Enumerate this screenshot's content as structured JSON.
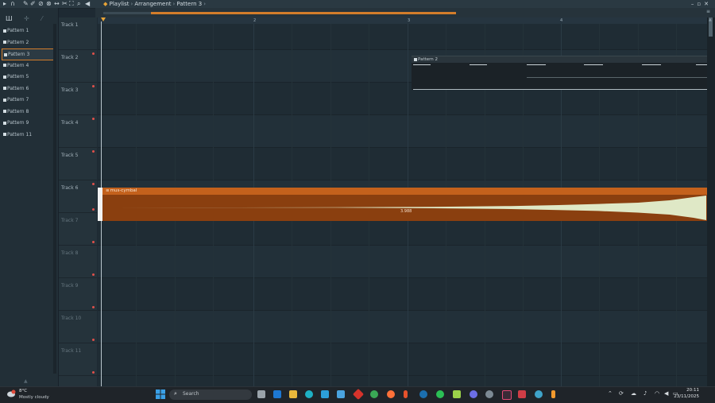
{
  "title": {
    "parts": [
      "Playlist",
      "Arrangement",
      "Pattern 3"
    ],
    "separator": "›",
    "trailing": "›"
  },
  "toolbar_icons": [
    "play-icon",
    "magnet-icon",
    "pencil-icon",
    "brush-icon",
    "delete-icon",
    "mute-icon",
    "slip-icon",
    "slice-icon",
    "select-icon",
    "zoom-icon",
    "speaker-icon"
  ],
  "left_panel": {
    "tools": [
      "piano-icon",
      "move-icon",
      "pencil-icon"
    ],
    "patterns": [
      "Pattern 1",
      "Pattern 2",
      "Pattern 3",
      "Pattern 4",
      "Pattern 5",
      "Pattern 6",
      "Pattern 7",
      "Pattern 8",
      "Pattern 9",
      "Pattern 11"
    ],
    "selected_index": 2
  },
  "ruler": {
    "bars": [
      "2",
      "3",
      "4"
    ]
  },
  "tracks": [
    "Track 1",
    "Track 2",
    "Track 3",
    "Track 4",
    "Track 5",
    "Track 6",
    "Track 7",
    "Track 8",
    "Track 9",
    "Track 10",
    "Track 11"
  ],
  "clips": {
    "pattern_clip": {
      "title": "Pattern 2",
      "track": "Track 2"
    },
    "audio_clip": {
      "title": "mus-cymbal",
      "track": "Track 6",
      "bar_label": "3.988"
    }
  },
  "colors": {
    "accent": "#d37d2b",
    "audio_clip": "#8a3f0f",
    "audio_header": "#c4611c",
    "track_dot": "#e0504a"
  },
  "taskbar": {
    "weather_temp": "8°C",
    "weather_desc": "Mostly cloudy",
    "search_placeholder": "Search",
    "time": "20:11",
    "date": "23/11/2025"
  }
}
